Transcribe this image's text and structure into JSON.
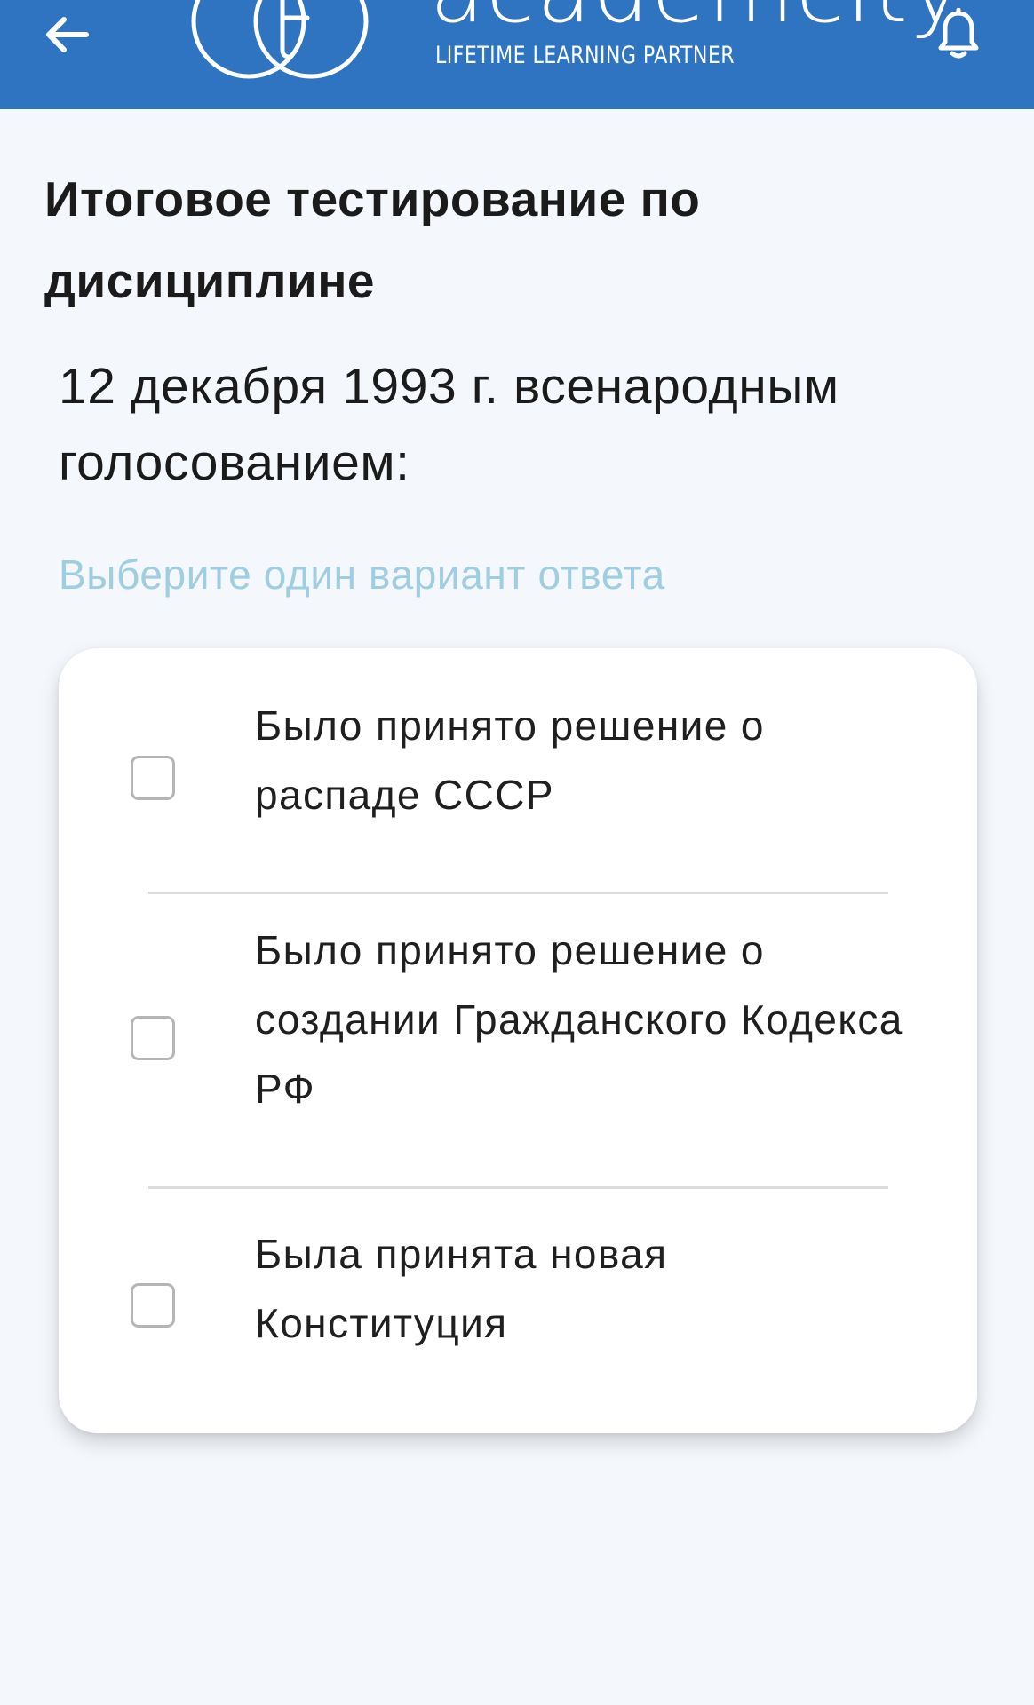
{
  "header": {
    "brand_name": "academcity",
    "tagline": "LIFETIME LEARNING PARTNER",
    "back_icon": "arrow-left-icon",
    "notification_icon": "bell-icon",
    "background_color": "#2f74c0"
  },
  "page": {
    "title": "Итоговое тестирование по дисициплине",
    "question": "12 декабря 1993 г. всенародным голосованием:",
    "hint": "Выберите один вариант ответа"
  },
  "options": [
    {
      "label": "Было принято решение о распаде СССР",
      "checked": false
    },
    {
      "label": "Было принято решение о создании Гражданского Кодекса РФ",
      "checked": false
    },
    {
      "label": "Была принята новая Конституция",
      "checked": false
    }
  ],
  "colors": {
    "accent": "#2f74c0",
    "hint": "#9fcde2",
    "text": "#1b1b1b",
    "background": "#f4f7fc"
  }
}
